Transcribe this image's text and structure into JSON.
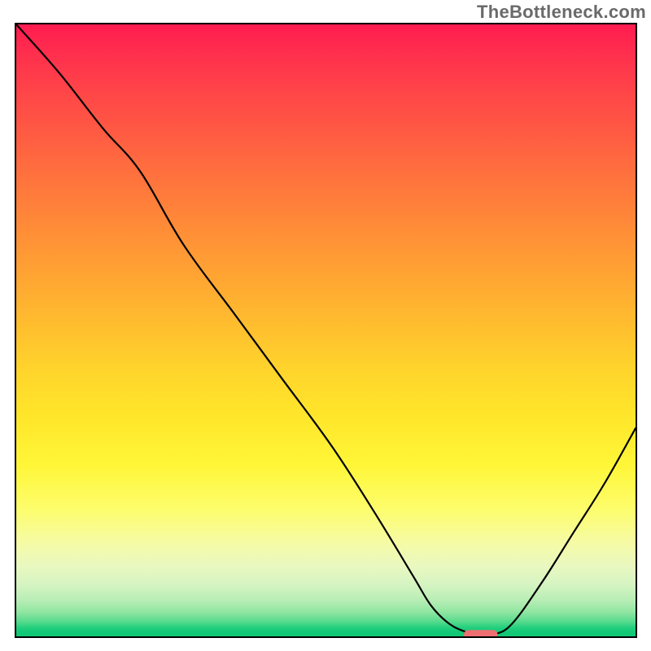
{
  "watermark": "TheBottleneck.com",
  "chart_data": {
    "type": "line",
    "title": "",
    "xlabel": "",
    "ylabel": "",
    "xlim": [
      0,
      100
    ],
    "ylim": [
      0,
      100
    ],
    "grid": false,
    "legend": false,
    "series": [
      {
        "name": "bottleneck-curve",
        "x": [
          0,
          7,
          14,
          20,
          27,
          35,
          43,
          51,
          58,
          64,
          67,
          70,
          73,
          75,
          77,
          80,
          85,
          90,
          95,
          100
        ],
        "values": [
          100,
          92,
          83,
          76,
          64,
          53,
          42,
          31,
          20,
          10,
          5,
          2,
          0.6,
          0.3,
          0.3,
          2,
          9,
          17,
          25,
          34
        ]
      }
    ],
    "marker": {
      "name": "optimal-range",
      "x_start": 73,
      "x_end": 77,
      "y": 0.3,
      "color": "#ee6e72"
    },
    "background_gradient": {
      "stops": [
        {
          "pos": 0,
          "color": "#ff1c50"
        },
        {
          "pos": 50,
          "color": "#ffc22e"
        },
        {
          "pos": 80,
          "color": "#fcfb88"
        },
        {
          "pos": 100,
          "color": "#11c876"
        }
      ]
    }
  }
}
